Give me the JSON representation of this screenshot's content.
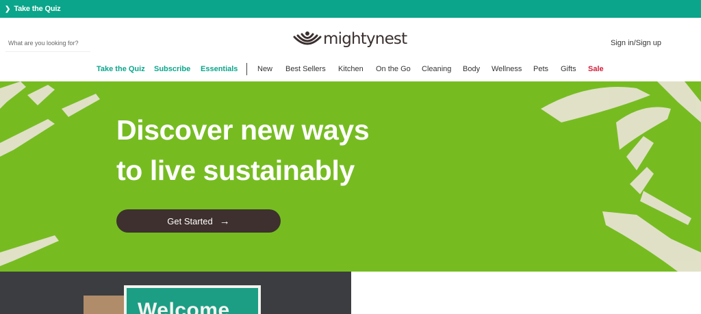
{
  "announcement": {
    "label": "Take the Quiz",
    "icon": "chevron-right-icon"
  },
  "header": {
    "search_placeholder": "What are you looking for?",
    "logo_text": "mightynest",
    "signin_label": "Sign in/Sign up"
  },
  "nav": {
    "featured": [
      "Take the Quiz",
      "Subscribe",
      "Essentials"
    ],
    "categories": [
      "New",
      "Best Sellers",
      "Kitchen",
      "On the Go",
      "Cleaning",
      "Body",
      "Wellness",
      "Pets",
      "Gifts"
    ],
    "sale": "Sale"
  },
  "hero": {
    "headline_line1": "Discover new ways",
    "headline_line2": "to live sustainably",
    "cta_label": "Get Started",
    "cta_icon": "arrow-right-icon"
  },
  "promo_image": {
    "box_text": "Welcome"
  },
  "colors": {
    "brand_teal": "#0aa58a",
    "hero_green": "#76bc21",
    "cta_dark": "#3d302e",
    "sale_red": "#d41d3b"
  }
}
